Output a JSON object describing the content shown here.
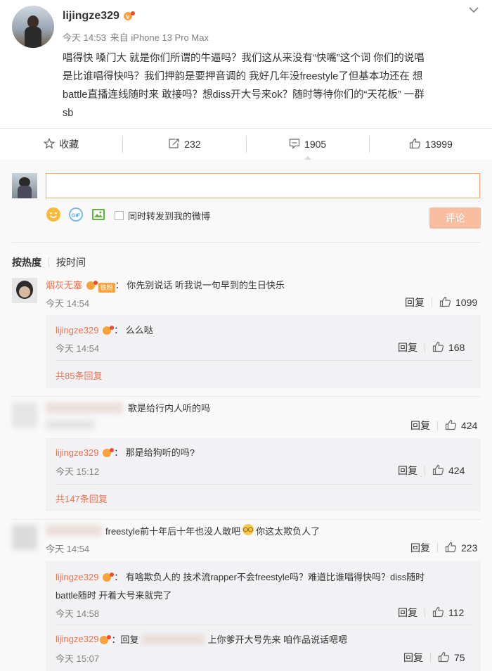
{
  "post": {
    "username": "lijingze329",
    "meta_time": "今天 14:53",
    "meta_source": "来自 iPhone 13 Pro Max",
    "text_line1": "唱得快 嗓门大 就是你们所谓的牛逼吗？我们这从来没有“快嘴”这个词 你们的说唱",
    "text_line2": "是比谁唱得快吗？我们押韵是要押音调的 我好几年没freestyle了但基本功还在 想",
    "text_line3": "battle直播连线随时来 敢接吗？想diss开大号来ok？随时等待你们的“天花板” 一群",
    "text_line4": "sb"
  },
  "actions": {
    "favorite": "收藏",
    "repost": "232",
    "comment": "1905",
    "like": "13999"
  },
  "compose": {
    "placeholder": "",
    "forward_label": "同时转发到我的微博",
    "submit": "评论"
  },
  "sort": {
    "hot": "按热度",
    "time": "按时间"
  },
  "comments": [
    {
      "name": "烟灰无塞",
      "badge": "铁粉",
      "text": "你先别说话 听我说一句早到的生日快乐",
      "time": "今天 14:54",
      "reply": "回复",
      "likes": "1099",
      "replies": [
        {
          "name": "lijingze329",
          "text": "么么哒",
          "time": "今天 14:54",
          "reply": "回复",
          "likes": "168"
        }
      ],
      "more": "共85条回复"
    },
    {
      "name": "",
      "text": "歌是给行内人听的吗",
      "time": "",
      "reply": "回复",
      "likes": "424",
      "replies": [
        {
          "name": "lijingze329",
          "text": "那是给狗听的吗?",
          "time": "今天 15:12",
          "reply": "回复",
          "likes": "424"
        }
      ],
      "more": "共147条回复"
    },
    {
      "name": "",
      "text_a": "freestyle前十年后十年也没人敢吧",
      "text_b": "你这太欺负人了",
      "time": "今天 14:54",
      "reply": "回复",
      "likes": "223",
      "replies": [
        {
          "name": "lijingze329",
          "text": "有啥欺负人的 技术流rapper不会freestyle吗？难道比谁唱得快吗？diss随时",
          "text2": "battle随时 开着大号来就完了",
          "time": "今天 14:58",
          "reply": "回复",
          "likes": "112"
        },
        {
          "name": "lijingze329",
          "text": "回复",
          "text_tail": "上你爹开大号先来 咱作品说话嗯嗯",
          "time": "今天 15:07",
          "reply": "回复",
          "likes": "75"
        }
      ]
    }
  ],
  "colors": {
    "accent": "#eb7350",
    "link": "#eb7350",
    "reply_bg": "#f2f2f5",
    "submit_bg": "#fbbd9f"
  }
}
